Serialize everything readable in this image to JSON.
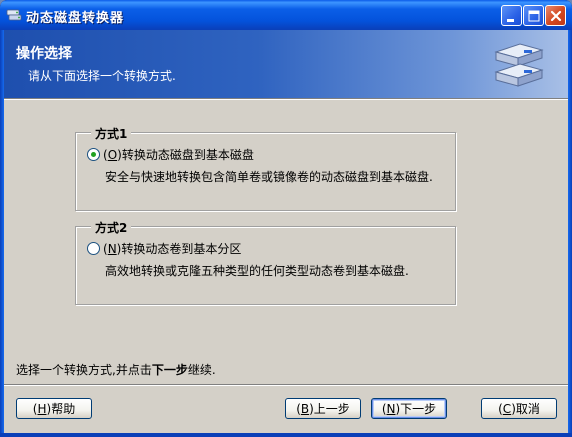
{
  "window": {
    "title": "动态磁盘转换器"
  },
  "header": {
    "title": "操作选择",
    "subtitle": "请从下面选择一个转换方式."
  },
  "option1": {
    "legend": "方式1",
    "label_prefix": "(",
    "hotkey": "O",
    "label_suffix": ")转换动态磁盘到基本磁盘",
    "description": "安全与快速地转换包含简单卷或镜像卷的动态磁盘到基本磁盘.",
    "checked": true
  },
  "option2": {
    "legend": "方式2",
    "label_prefix": "(",
    "hotkey": "N",
    "label_suffix": ")转换动态卷到基本分区",
    "description": "高效地转换或克隆五种类型的任何类型动态卷到基本磁盘.",
    "checked": false
  },
  "footer": {
    "text_before": "选择一个转换方式,并点击",
    "text_bold": "下一步",
    "text_after": "继续."
  },
  "buttons": {
    "help": {
      "prefix": "(",
      "hotkey": "H",
      "suffix": ")帮助"
    },
    "prev": {
      "prefix": "(",
      "hotkey": "B",
      "suffix": ")上一步"
    },
    "next": {
      "prefix": "(",
      "hotkey": "N",
      "suffix": ")下一步"
    },
    "cancel": {
      "prefix": "(",
      "hotkey": "C",
      "suffix": ")取消"
    }
  },
  "icons": {
    "app": "disk-converter-icon",
    "header": "disk-drives-icon",
    "minimize": "minimize-icon",
    "maximize": "maximize-icon",
    "close": "close-icon"
  },
  "colors": {
    "titlebar": "#0452db",
    "header_gradient_start": "#1e4fae",
    "header_gradient_end": "#a9c0e6",
    "client": "#d4d0c8",
    "radio_dot": "#21a121",
    "close_button": "#d3471f"
  }
}
